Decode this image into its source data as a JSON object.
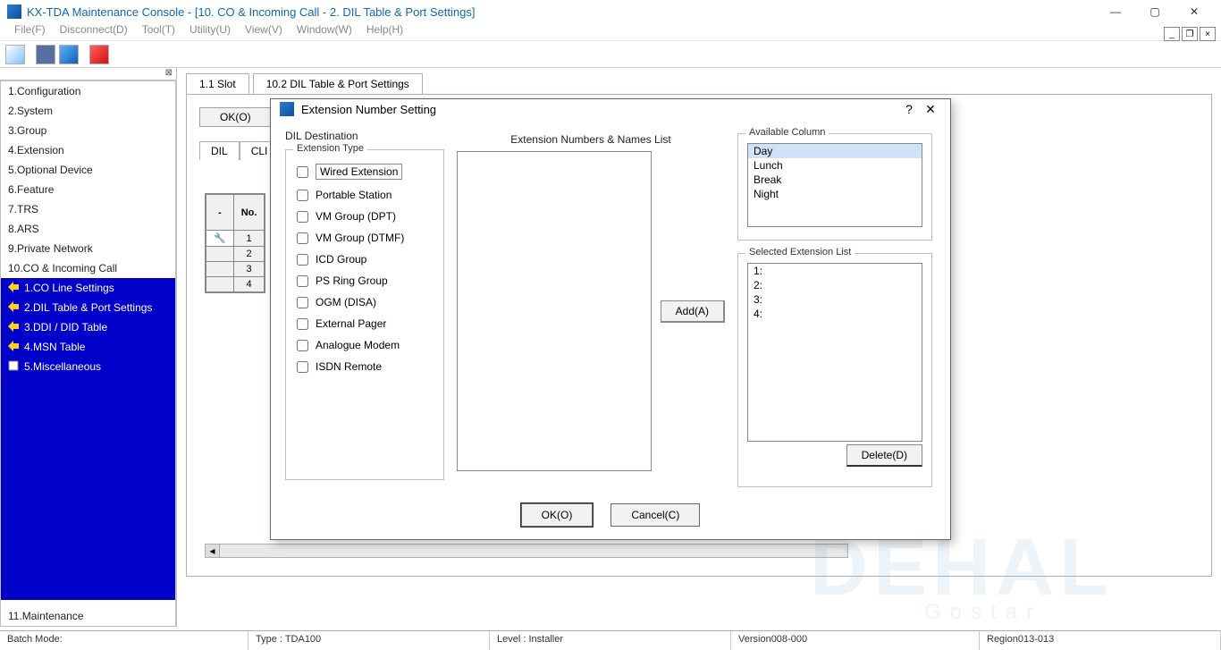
{
  "window": {
    "title": "KX-TDA Maintenance Console - [10. CO & Incoming Call - 2. DIL Table & Port Settings]"
  },
  "menu": {
    "items": [
      "File(F)",
      "Disconnect(D)",
      "Tool(T)",
      "Utility(U)",
      "View(V)",
      "Window(W)",
      "Help(H)"
    ]
  },
  "nav": {
    "items": [
      "1.Configuration",
      "2.System",
      "3.Group",
      "4.Extension",
      "5.Optional Device",
      "6.Feature",
      "7.TRS",
      "8.ARS",
      "9.Private Network",
      "10.CO & Incoming Call"
    ],
    "subs": [
      "1.CO Line Settings",
      "2.DIL Table & Port Settings",
      "3.DDI / DID Table",
      "4.MSN Table",
      "5.Miscellaneous"
    ],
    "bottom": "11.Maintenance"
  },
  "tabs": {
    "main": [
      "1.1 Slot",
      "10.2 DIL Table & Port Settings"
    ],
    "btn_ok": "OK(O)",
    "sub": [
      "DIL",
      "CLI for"
    ]
  },
  "grid": {
    "cols": [
      "-",
      "No."
    ],
    "rows": [
      "1",
      "2",
      "3",
      "4"
    ]
  },
  "modal": {
    "title": "Extension Number Setting",
    "dil_dest": "DIL Destination",
    "ext_nums_label": "Extension Numbers & Names List",
    "ext_type_legend": "Extension Type",
    "ext_types": [
      "Wired Extension",
      "Portable Station",
      "VM Group (DPT)",
      "VM Group (DTMF)",
      "ICD Group",
      "PS Ring Group",
      "OGM (DISA)",
      "External Pager",
      "Analogue Modem",
      "ISDN Remote"
    ],
    "avail_col_legend": "Available Column",
    "avail_cols": [
      "Day",
      "Lunch",
      "Break",
      "Night"
    ],
    "sel_ext_legend": "Selected Extension List",
    "sel_ext": [
      "1:",
      "2:",
      "3:",
      "4:"
    ],
    "add_btn": "Add(A)",
    "delete_btn": "Delete(D)",
    "ok_btn": "OK(O)",
    "cancel_btn": "Cancel(C)"
  },
  "status": {
    "batch": "Batch Mode:",
    "type": "Type : TDA100",
    "level": "Level : Installer",
    "version": "Version008-000",
    "region": "Region013-013"
  }
}
